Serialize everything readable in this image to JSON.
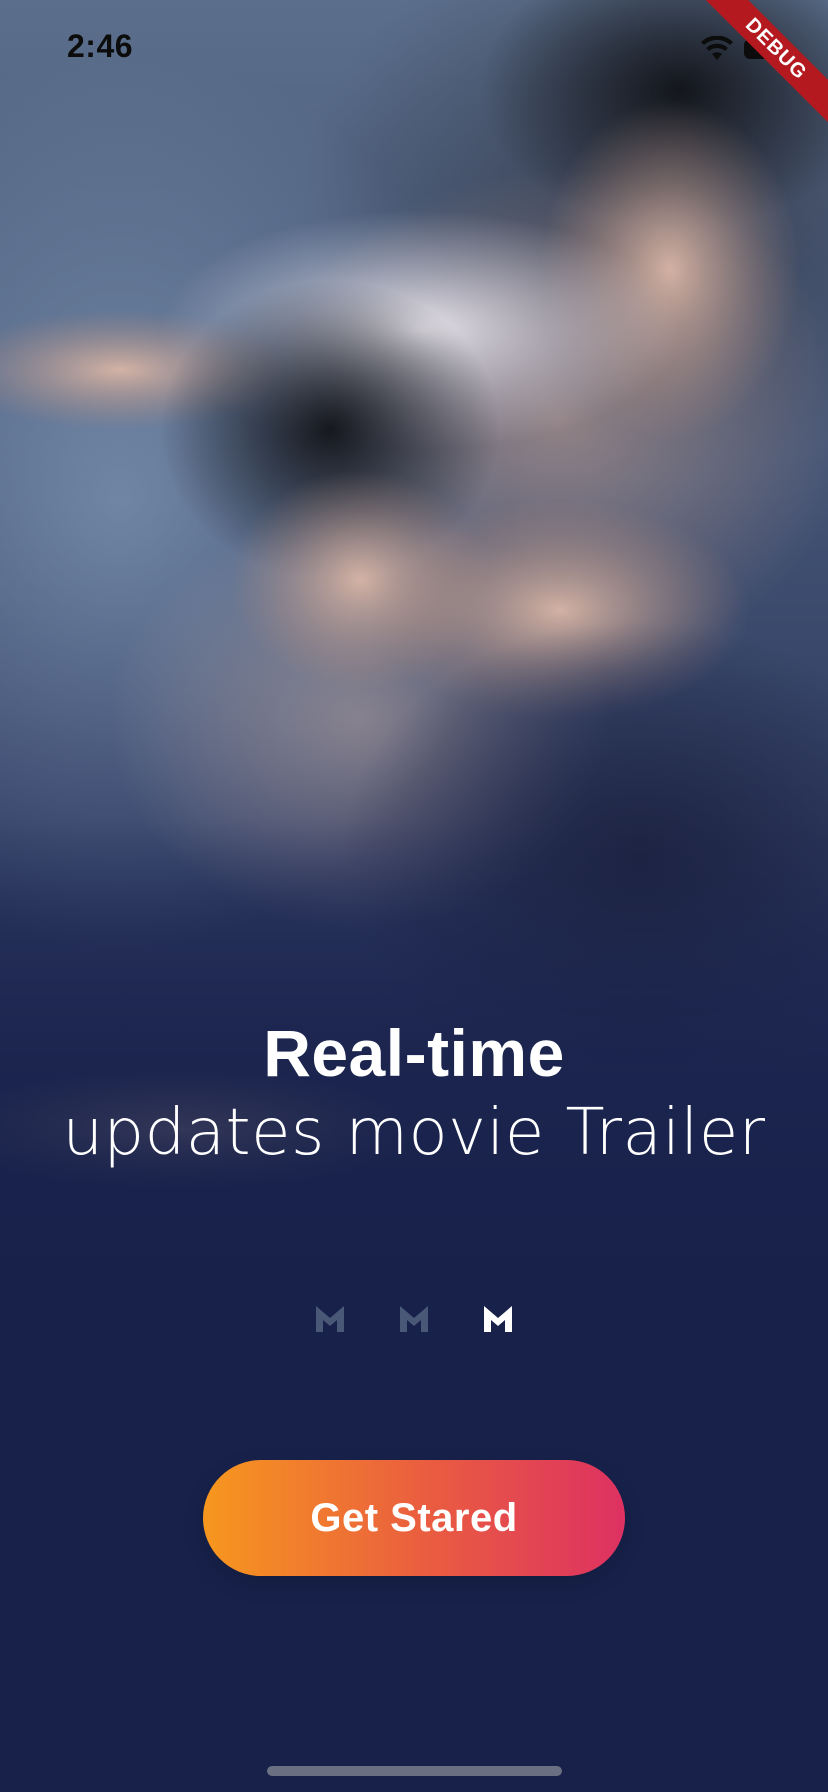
{
  "status_bar": {
    "time": "2:46",
    "wifi_icon": "wifi-icon",
    "battery_icon": "battery-icon"
  },
  "debug_banner": {
    "label": "DEBUG",
    "color": "#b3191e"
  },
  "hero": {
    "image_icon": "movie-poster-image"
  },
  "onboarding": {
    "headline": "Real-time",
    "subheadline": "updates movie Trailer",
    "pages": [
      {
        "icon": "m-logo-icon",
        "active": false
      },
      {
        "icon": "m-logo-icon",
        "active": false
      },
      {
        "icon": "m-logo-icon",
        "active": true
      }
    ],
    "current_page": 3,
    "page_count": 3
  },
  "cta": {
    "label": "Get Stared",
    "gradient_start": "#f7971e",
    "gradient_end": "#dd3162"
  },
  "colors": {
    "background": "#17214a",
    "text": "#ffffff",
    "indicator_inactive": "#4a5877",
    "indicator_active": "#ffffff"
  }
}
